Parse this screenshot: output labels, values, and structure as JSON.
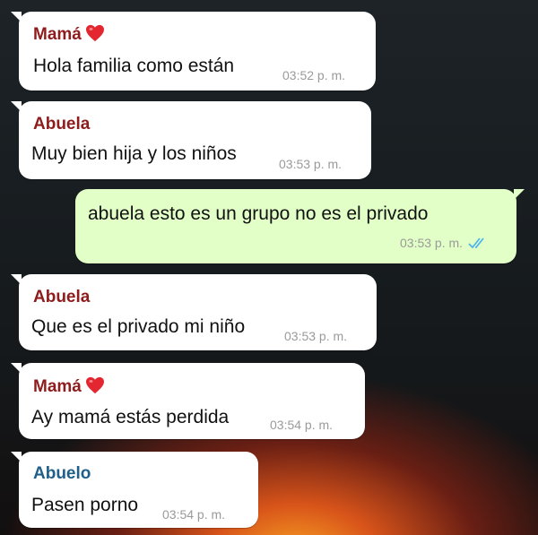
{
  "colors": {
    "sender_mama": "#8e1c1c",
    "sender_abuela": "#8e1c1c",
    "sender_abuelo": "#1f5f8a",
    "outgoing_bubble": "#e2ffc7",
    "incoming_bubble": "#ffffff",
    "read_ticks": "#4fb6ec"
  },
  "messages": [
    {
      "sender": "Mamá",
      "sender_icon": "red-heart-icon",
      "text": "Hola familia como están",
      "time": "03:52 p. m."
    },
    {
      "sender": "Abuela",
      "text": "Muy bien hija y los niños",
      "time": "03:53 p. m."
    },
    {
      "text": "abuela esto es un grupo no es el privado",
      "time": "03:53 p. m.",
      "status_icon": "double-check-read-icon"
    },
    {
      "sender": "Abuela",
      "text": "Que es el privado mi niño",
      "time": "03:53 p. m."
    },
    {
      "sender": "Mamá",
      "sender_icon": "red-heart-icon",
      "text": "Ay mamá estás perdida",
      "time": "03:54 p. m."
    },
    {
      "sender": "Abuelo",
      "text": "Pasen porno",
      "time": "03:54 p. m."
    }
  ]
}
